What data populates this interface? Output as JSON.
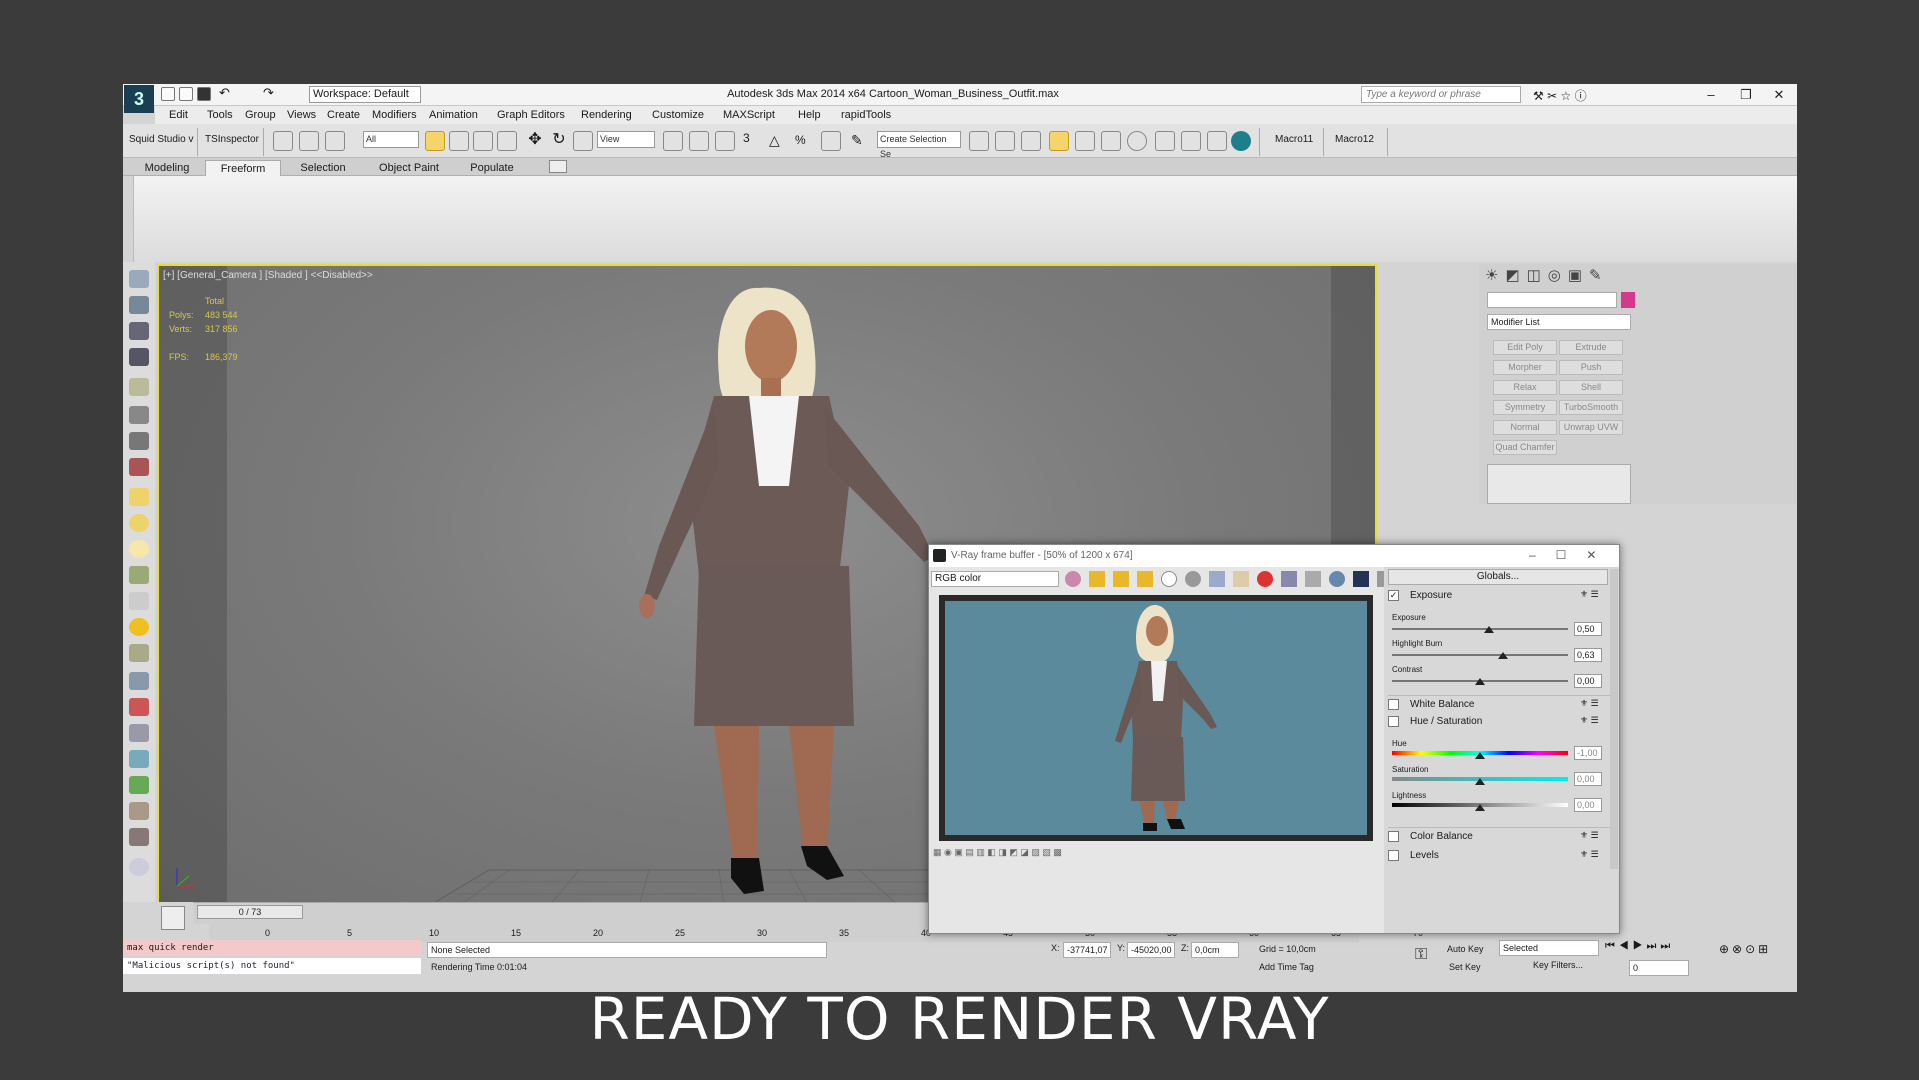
{
  "app": {
    "title": "Autodesk 3ds Max  2014 x64     Cartoon_Woman_Business_Outfit.max",
    "workspace": "Workspace: Default",
    "search_placeholder": "Type a keyword or phrase"
  },
  "menu": [
    "Edit",
    "Tools",
    "Group",
    "Views",
    "Create",
    "Modifiers",
    "Animation",
    "Graph Editors",
    "Rendering",
    "Customize",
    "MAXScript",
    "Help",
    "rapidTools"
  ],
  "toolbar": {
    "squid": "Squid Studio v",
    "tsinspector": "TSInspector",
    "filter": "All",
    "view": "View",
    "create_sel": "Create Selection Se",
    "macro11": "Macro11",
    "macro12": "Macro12"
  },
  "ribbon_tabs": [
    "Modeling",
    "Freeform",
    "Selection",
    "Object Paint",
    "Populate"
  ],
  "viewport": {
    "label": "[+] [General_Camera ] [Shaded ]  <<Disabled>>",
    "total": "Total",
    "polys_label": "Polys:",
    "polys": "483 544",
    "verts_label": "Verts:",
    "verts": "317 856",
    "fps_label": "FPS:",
    "fps": "186,379"
  },
  "cmd": {
    "modifier_list": "Modifier List",
    "buttons": [
      "Edit Poly",
      "Extrude",
      "Morpher",
      "Push",
      "Relax",
      "Shell",
      "Symmetry",
      "TurboSmooth",
      "Normal",
      "Unwrap UVW",
      "Quad Chamfer"
    ]
  },
  "vfb": {
    "title": "V-Ray frame buffer - [50% of 1200 x 674]",
    "channel": "RGB color",
    "globals": "Globals...",
    "exposure": "Exposure",
    "exposure_l": "Exposure",
    "exposure_v": "0,50",
    "highlight_l": "Highlight Burn",
    "highlight_v": "0,63",
    "contrast_l": "Contrast",
    "contrast_v": "0,00",
    "wb": "White Balance",
    "hs": "Hue / Saturation",
    "hue_l": "Hue",
    "hue_v": "-1,00",
    "sat_l": "Saturation",
    "sat_v": "0,00",
    "light_l": "Lightness",
    "light_v": "0,00",
    "cb": "Color Balance",
    "levels": "Levels"
  },
  "sliders": {
    "exposure": 0.55,
    "highlight": 0.63,
    "contrast": 0.5,
    "hue": 0.5,
    "sat": 0.5,
    "light": 0.5
  },
  "status": {
    "frame": "0 / 73",
    "ticks": [
      "0",
      "5",
      "10",
      "15",
      "20",
      "25",
      "30",
      "35",
      "40",
      "45",
      "50",
      "55",
      "60",
      "65",
      "70"
    ],
    "maxscript": "max quick render",
    "maxscript_out": "\"Malicious script(s) not found\"",
    "selection": "None Selected",
    "render_time": "Rendering Time  0:01:04",
    "x": "-37741,07",
    "y": "-45020,00",
    "z": "0,0cm",
    "grid": "Grid = 10,0cm",
    "add_time_tag": "Add Time Tag",
    "autokey": "Auto Key",
    "setkey": "Set Key",
    "selected": "Selected",
    "keyfilters": "Key Filters...",
    "frame_field": "0"
  },
  "caption": "READY TO RENDER VRAY"
}
